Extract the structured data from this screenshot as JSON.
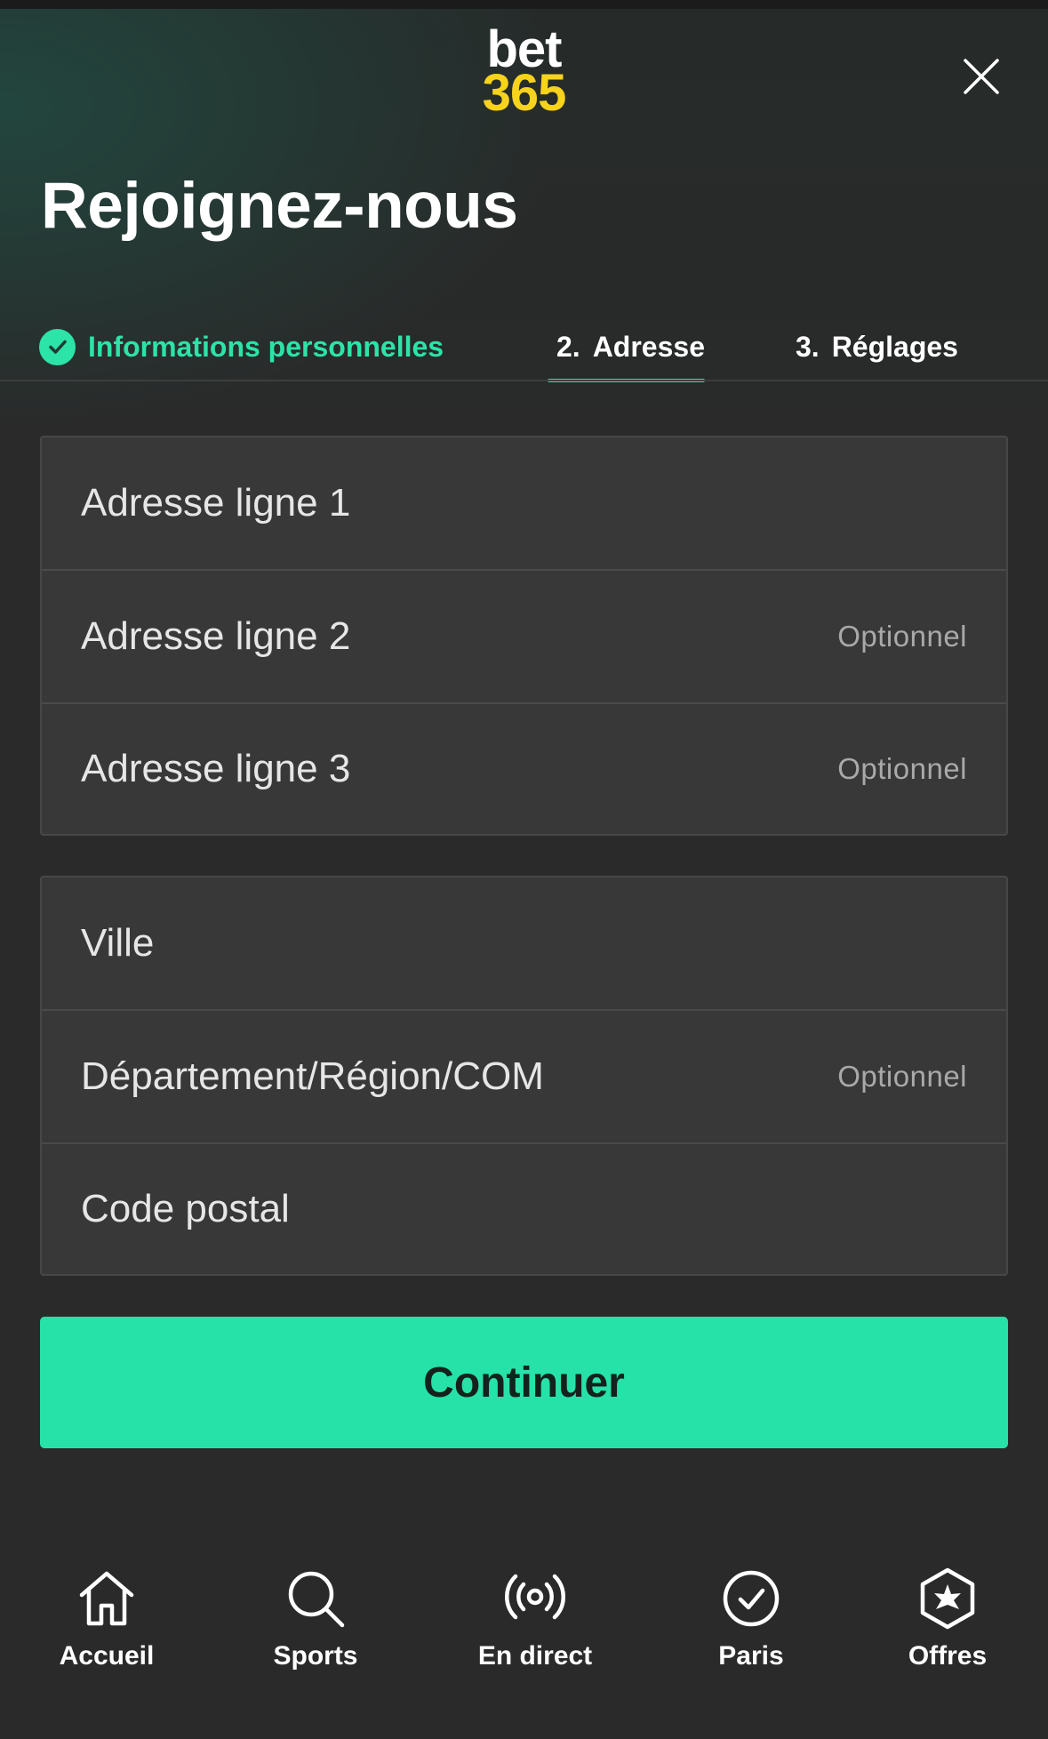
{
  "header": {
    "logo_top": "bet",
    "logo_bottom": "365",
    "close_icon": "close-icon"
  },
  "title": "Rejoignez-nous",
  "steps": [
    {
      "label": "Informations personnelles",
      "state": "done"
    },
    {
      "number": "2.",
      "label": "Adresse",
      "state": "active"
    },
    {
      "number": "3.",
      "label": "Réglages",
      "state": "pending"
    }
  ],
  "address_group": [
    {
      "label": "Adresse ligne 1",
      "optional": ""
    },
    {
      "label": "Adresse ligne 2",
      "optional": "Optionnel"
    },
    {
      "label": "Adresse ligne 3",
      "optional": "Optionnel"
    }
  ],
  "location_group": [
    {
      "label": "Ville",
      "optional": ""
    },
    {
      "label": "Département/Région/COM",
      "optional": "Optionnel"
    },
    {
      "label": "Code postal",
      "optional": ""
    }
  ],
  "continue_label": "Continuer",
  "bottom_nav": [
    {
      "label": "Accueil",
      "icon": "home-icon"
    },
    {
      "label": "Sports",
      "icon": "search-icon"
    },
    {
      "label": "En direct",
      "icon": "live-broadcast-icon"
    },
    {
      "label": "Paris",
      "icon": "check-circle-icon"
    },
    {
      "label": "Offres",
      "icon": "star-badge-icon"
    }
  ],
  "colors": {
    "accent": "#26e2a8",
    "logo_yellow": "#f7d31c",
    "background": "#2a2a2a",
    "field_bg": "#383838"
  }
}
